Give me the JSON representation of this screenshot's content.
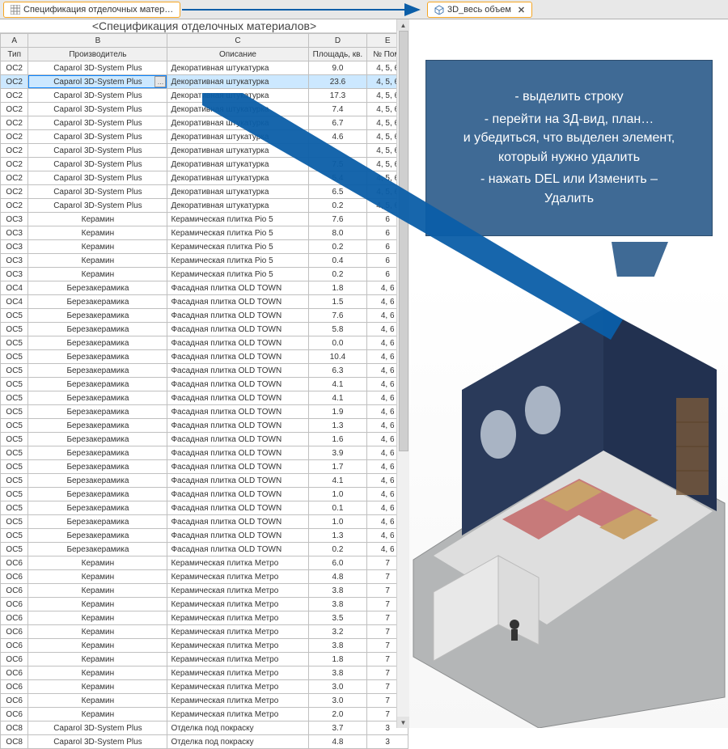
{
  "tabs": {
    "left": {
      "label": "Спецификация отделочных матер…"
    },
    "right": {
      "label": "3D_весь объем"
    }
  },
  "schedule": {
    "title": "<Спецификация отделочных материалов>",
    "cols_letters": [
      "A",
      "B",
      "C",
      "D",
      "E"
    ],
    "cols_headers": [
      "Тип",
      "Производитель",
      "Описание",
      "Площадь, кв.",
      "№ Пом."
    ],
    "selected_row_index": 1,
    "rows": [
      [
        "ОС2",
        "Caparol 3D-System Plus",
        "Декоративная штукатурка",
        "9.0",
        "4, 5, 6"
      ],
      [
        "ОС2",
        "Caparol 3D-System Plus",
        "Декоративная штукатурка",
        "23.6",
        "4, 5, 6"
      ],
      [
        "ОС2",
        "Caparol 3D-System Plus",
        "Декоративная штукатурка",
        "17.3",
        "4, 5, 6"
      ],
      [
        "ОС2",
        "Caparol 3D-System Plus",
        "Декоративная штукатурка",
        "7.4",
        "4, 5, 6"
      ],
      [
        "ОС2",
        "Caparol 3D-System Plus",
        "Декоративная штукатурка",
        "6.7",
        "4, 5, 6"
      ],
      [
        "ОС2",
        "Caparol 3D-System Plus",
        "Декоративная штукатурка",
        "4.6",
        "4, 5, 6"
      ],
      [
        "ОС2",
        "Caparol 3D-System Plus",
        "Декоративная штукатурка",
        "",
        "4, 5, 6"
      ],
      [
        "ОС2",
        "Caparol 3D-System Plus",
        "Декоративная штукатурка",
        "7.5",
        "4, 5, 6"
      ],
      [
        "ОС2",
        "Caparol 3D-System Plus",
        "Декоративная штукатурка",
        "5.4",
        "4, 5, 6"
      ],
      [
        "ОС2",
        "Caparol 3D-System Plus",
        "Декоративная штукатурка",
        "6.5",
        "4, 5, 6"
      ],
      [
        "ОС2",
        "Caparol 3D-System Plus",
        "Декоративная штукатурка",
        "0.2",
        "4, 5, 6"
      ],
      [
        "ОС3",
        "Керамин",
        "Керамическая плитка Pio 5",
        "7.6",
        "6"
      ],
      [
        "ОС3",
        "Керамин",
        "Керамическая плитка Pio 5",
        "8.0",
        "6"
      ],
      [
        "ОС3",
        "Керамин",
        "Керамическая плитка Pio 5",
        "0.2",
        "6"
      ],
      [
        "ОС3",
        "Керамин",
        "Керамическая плитка Pio 5",
        "0.4",
        "6"
      ],
      [
        "ОС3",
        "Керамин",
        "Керамическая плитка Pio 5",
        "0.2",
        "6"
      ],
      [
        "ОС4",
        "Березакерамика",
        "Фасадная плитка OLD TOWN",
        "1.8",
        "4, 6"
      ],
      [
        "ОС4",
        "Березакерамика",
        "Фасадная плитка OLD TOWN",
        "1.5",
        "4, 6"
      ],
      [
        "ОС5",
        "Березакерамика",
        "Фасадная плитка OLD TOWN",
        "7.6",
        "4, 6"
      ],
      [
        "ОС5",
        "Березакерамика",
        "Фасадная плитка OLD TOWN",
        "5.8",
        "4, 6"
      ],
      [
        "ОС5",
        "Березакерамика",
        "Фасадная плитка OLD TOWN",
        "0.0",
        "4, 6"
      ],
      [
        "ОС5",
        "Березакерамика",
        "Фасадная плитка OLD TOWN",
        "10.4",
        "4, 6"
      ],
      [
        "ОС5",
        "Березакерамика",
        "Фасадная плитка OLD TOWN",
        "6.3",
        "4, 6"
      ],
      [
        "ОС5",
        "Березакерамика",
        "Фасадная плитка OLD TOWN",
        "4.1",
        "4, 6"
      ],
      [
        "ОС5",
        "Березакерамика",
        "Фасадная плитка OLD TOWN",
        "4.1",
        "4, 6"
      ],
      [
        "ОС5",
        "Березакерамика",
        "Фасадная плитка OLD TOWN",
        "1.9",
        "4, 6"
      ],
      [
        "ОС5",
        "Березакерамика",
        "Фасадная плитка OLD TOWN",
        "1.3",
        "4, 6"
      ],
      [
        "ОС5",
        "Березакерамика",
        "Фасадная плитка OLD TOWN",
        "1.6",
        "4, 6"
      ],
      [
        "ОС5",
        "Березакерамика",
        "Фасадная плитка OLD TOWN",
        "3.9",
        "4, 6"
      ],
      [
        "ОС5",
        "Березакерамика",
        "Фасадная плитка OLD TOWN",
        "1.7",
        "4, 6"
      ],
      [
        "ОС5",
        "Березакерамика",
        "Фасадная плитка OLD TOWN",
        "4.1",
        "4, 6"
      ],
      [
        "ОС5",
        "Березакерамика",
        "Фасадная плитка OLD TOWN",
        "1.0",
        "4, 6"
      ],
      [
        "ОС5",
        "Березакерамика",
        "Фасадная плитка OLD TOWN",
        "0.1",
        "4, 6"
      ],
      [
        "ОС5",
        "Березакерамика",
        "Фасадная плитка OLD TOWN",
        "1.0",
        "4, 6"
      ],
      [
        "ОС5",
        "Березакерамика",
        "Фасадная плитка OLD TOWN",
        "1.3",
        "4, 6"
      ],
      [
        "ОС5",
        "Березакерамика",
        "Фасадная плитка OLD TOWN",
        "0.2",
        "4, 6"
      ],
      [
        "ОС6",
        "Керамин",
        "Керамическая плитка Метро",
        "6.0",
        "7"
      ],
      [
        "ОС6",
        "Керамин",
        "Керамическая плитка Метро",
        "4.8",
        "7"
      ],
      [
        "ОС6",
        "Керамин",
        "Керамическая плитка Метро",
        "3.8",
        "7"
      ],
      [
        "ОС6",
        "Керамин",
        "Керамическая плитка Метро",
        "3.8",
        "7"
      ],
      [
        "ОС6",
        "Керамин",
        "Керамическая плитка Метро",
        "3.5",
        "7"
      ],
      [
        "ОС6",
        "Керамин",
        "Керамическая плитка Метро",
        "3.2",
        "7"
      ],
      [
        "ОС6",
        "Керамин",
        "Керамическая плитка Метро",
        "3.8",
        "7"
      ],
      [
        "ОС6",
        "Керамин",
        "Керамическая плитка Метро",
        "1.8",
        "7"
      ],
      [
        "ОС6",
        "Керамин",
        "Керамическая плитка Метро",
        "3.8",
        "7"
      ],
      [
        "ОС6",
        "Керамин",
        "Керамическая плитка Метро",
        "3.0",
        "7"
      ],
      [
        "ОС6",
        "Керамин",
        "Керамическая плитка Метро",
        "3.0",
        "7"
      ],
      [
        "ОС6",
        "Керамин",
        "Керамическая плитка Метро",
        "2.0",
        "7"
      ],
      [
        "ОС8",
        "Caparol 3D-System Plus",
        "Отделка под покраску",
        "3.7",
        "3"
      ],
      [
        "ОС8",
        "Caparol 3D-System Plus",
        "Отделка под покраску",
        "4.8",
        "3"
      ]
    ]
  },
  "callout": {
    "line1": "- выделить строку",
    "line2": "- перейти на 3Д-вид, план…",
    "line3": "и убедиться, что выделен элемент,",
    "line4": "который нужно удалить",
    "line5": "- нажать DEL или Изменить –",
    "line6": "Удалить"
  }
}
